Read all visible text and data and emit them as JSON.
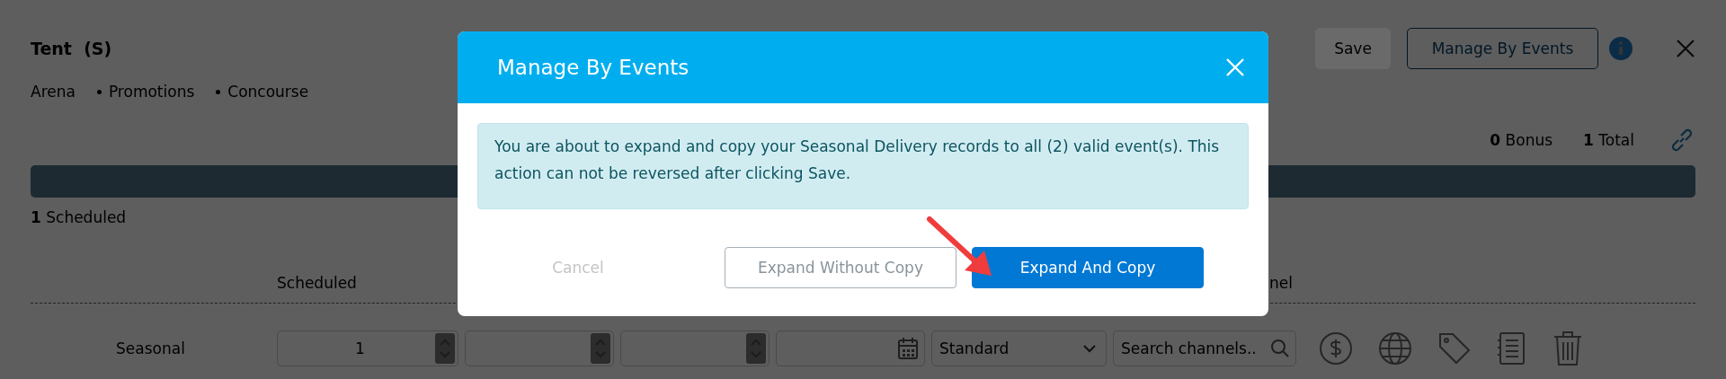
{
  "page": {
    "title": "Tent  (S)",
    "breadcrumbs": [
      "Arena",
      "Promotions",
      "Concourse"
    ],
    "actions": [
      {
        "label": "Save",
        "kind": "disabled"
      },
      {
        "label": "Manage By Events",
        "kind": "outline"
      }
    ],
    "summary": [
      {
        "count": "0",
        "label": "Bonus"
      },
      {
        "count": "1",
        "label": "Total"
      }
    ],
    "scheduled": {
      "count": "1",
      "label": "Scheduled"
    },
    "table": {
      "columns": [
        "Scheduled",
        "nel"
      ],
      "rows": [
        {
          "label": "Seasonal",
          "quantity": "1",
          "type": "Standard",
          "channel_placeholder": "Search channels.."
        }
      ]
    }
  },
  "modal": {
    "title": "Manage By Events",
    "message": "You are about to expand and copy your Seasonal Delivery records to all (2) valid event(s). This action can not be reversed after clicking Save.",
    "buttons": [
      {
        "label": "Cancel",
        "kind": "link"
      },
      {
        "label": "Expand Without Copy",
        "kind": "outline"
      },
      {
        "label": "Expand And Copy",
        "kind": "primary"
      }
    ]
  }
}
